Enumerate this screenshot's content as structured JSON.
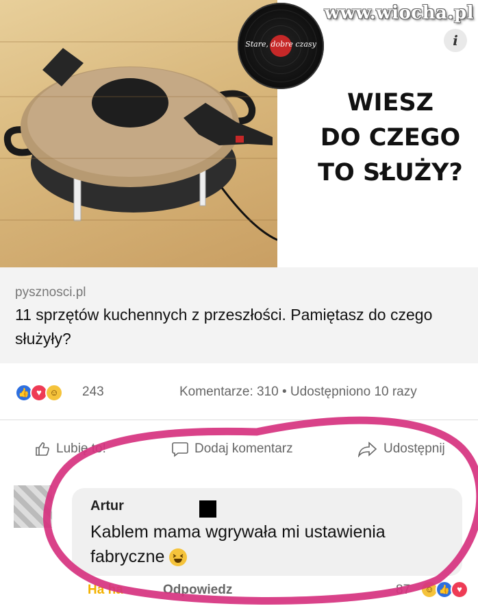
{
  "watermark": "www.wiocha.pl",
  "record_label": "Stare, dobre czasy",
  "info_glyph": "i",
  "headline": [
    "WIESZ",
    "DO CZEGO",
    "TO SŁUŻY?"
  ],
  "link": {
    "domain": "pysznosci.pl",
    "title": "11 sprzętów kuchennych z przeszłości. Pamiętasz do czego służyły?"
  },
  "stats": {
    "reaction_count": "243",
    "comments_shares": "Komentarze: 310 • Udostępniono 10 razy"
  },
  "actions": {
    "like": "Lubię to!",
    "comment": "Dodaj komentarz",
    "share": "Udostępnij"
  },
  "comment": {
    "author": "Artur",
    "text": "Kablem mama wgrywała mi ustawienia fabryczne",
    "reply_left": "Ha ha",
    "reply_mid": "Odpowiedz",
    "reaction_count": "87"
  },
  "colors": {
    "like_blue": "#2d6fe0",
    "love_red": "#ee3b55",
    "haha_yellow": "#f5c33b",
    "marker_pink": "#d6327f"
  },
  "icons": [
    "like-thumb-icon",
    "comment-bubble-icon",
    "share-arrow-icon",
    "info-icon"
  ]
}
